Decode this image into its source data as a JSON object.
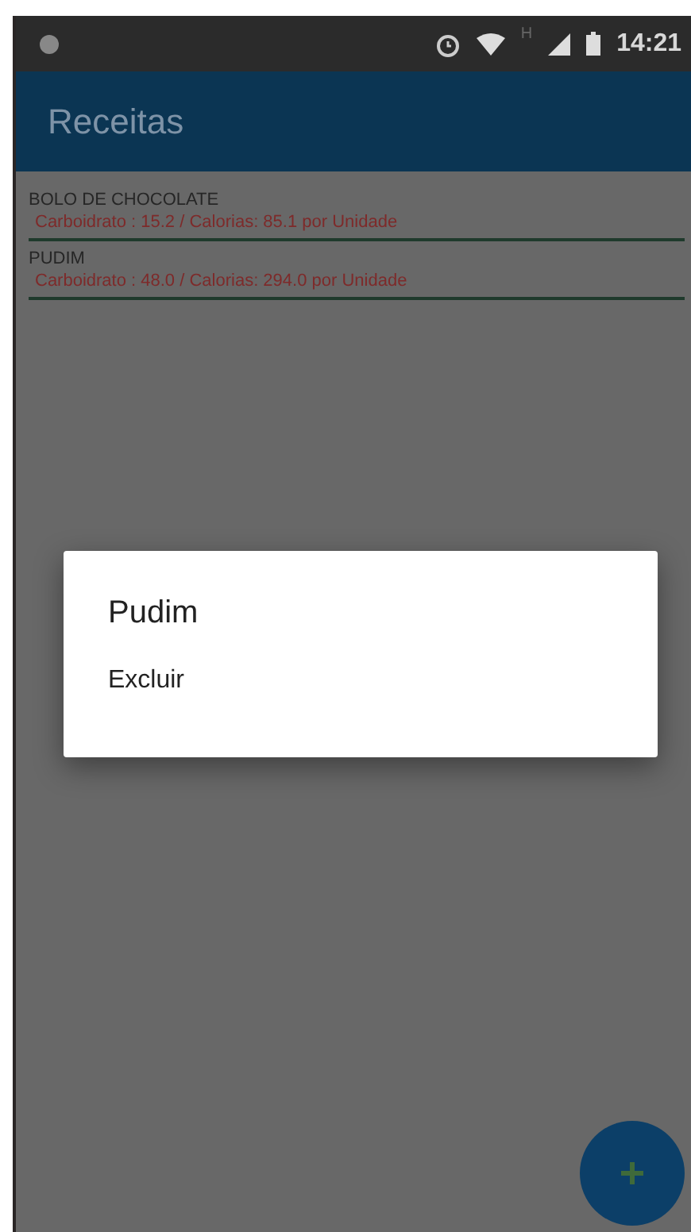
{
  "status_bar": {
    "time": "14:21",
    "network_label": "H"
  },
  "app_bar": {
    "title": "Receitas"
  },
  "recipes": [
    {
      "name": "BOLO DE CHOCOLATE",
      "details": "Carboidrato : 15.2 / Calorias: 85.1 por Unidade"
    },
    {
      "name": "PUDIM",
      "details": "Carboidrato : 48.0 / Calorias: 294.0 por Unidade"
    }
  ],
  "dialog": {
    "title": "Pudim",
    "options": [
      "Excluir"
    ]
  }
}
